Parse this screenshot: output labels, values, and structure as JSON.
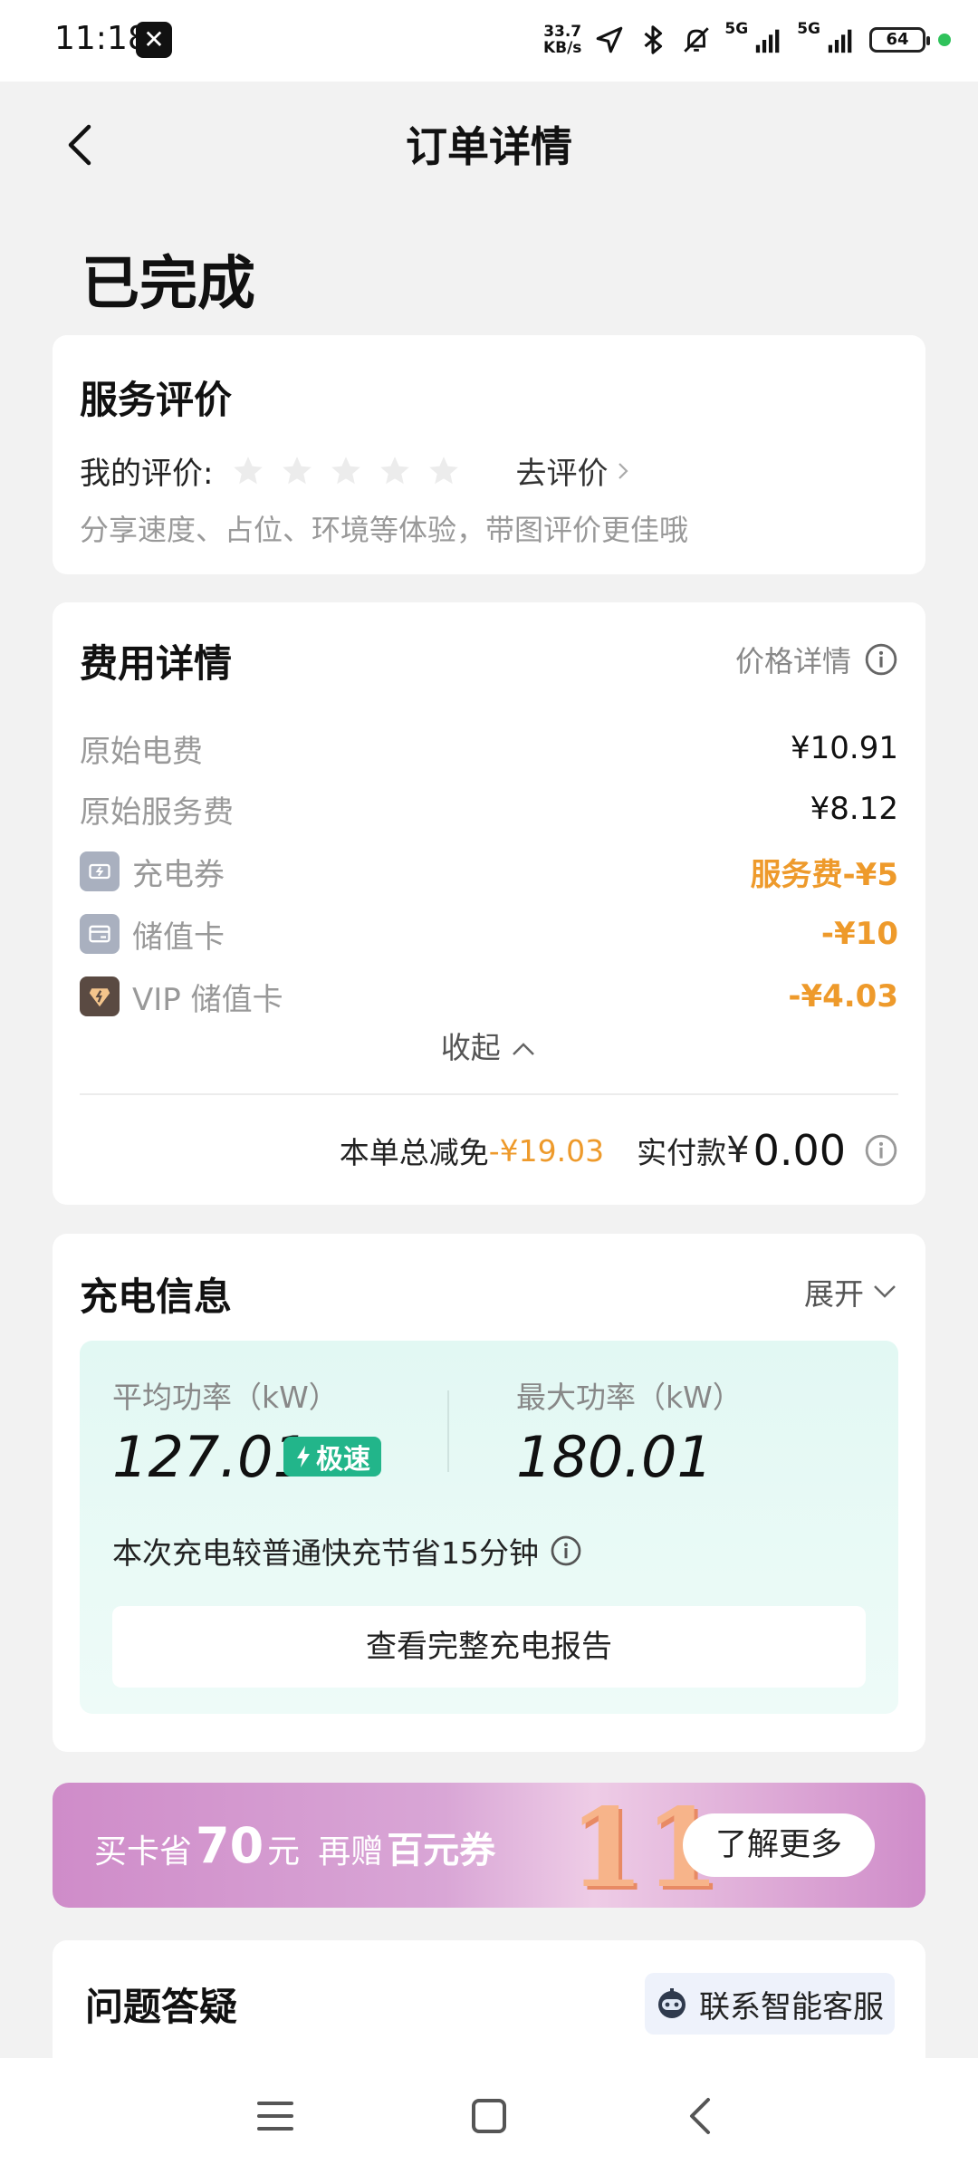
{
  "status_bar": {
    "time": "11:18",
    "notif_icon": "x-app-icon",
    "net_speed_value": "33.7",
    "net_speed_unit": "KB/s",
    "sim1": "5G",
    "sim2": "5G",
    "battery": "64"
  },
  "header": {
    "title": "订单详情",
    "back_icon": "chevron-left-icon"
  },
  "order_status": "已完成",
  "rating": {
    "title": "服务评价",
    "label": "我的评价:",
    "stars_filled": 0,
    "stars_total": 5,
    "go_rate": "去评价",
    "hint": "分享速度、占位、环境等体验，带图评价更佳哦"
  },
  "fees": {
    "title": "费用详情",
    "price_detail": "价格详情",
    "rows": [
      {
        "name": "原始电费",
        "value": "¥10.91",
        "icon": ""
      },
      {
        "name": "原始服务费",
        "value": "¥8.12",
        "icon": ""
      },
      {
        "name": "充电券",
        "value": "服务费-¥5",
        "icon": "coupon-icon"
      },
      {
        "name": "储值卡",
        "value": "-¥10",
        "icon": "card-icon"
      },
      {
        "name": "VIP 储值卡",
        "value": "-¥4.03",
        "icon": "vip-card-icon"
      }
    ],
    "collapse": "收起",
    "total_label": "本单总减免",
    "total_discount": "-¥19.03",
    "paid_label": "实付款",
    "paid_currency": "¥",
    "paid_amount": "0.00"
  },
  "charging": {
    "title": "充电信息",
    "expand": "展开",
    "avg_label": "平均功率（kW）",
    "avg_value": "127.01",
    "fast_badge": "极速",
    "max_label": "最大功率（kW）",
    "max_value": "180.01",
    "save_text": "本次充电较普通快充节省15分钟",
    "report_btn": "查看完整充电报告"
  },
  "promo": {
    "prefix": "买卡省",
    "amount": "70",
    "unit": "元",
    "mid": "再赠",
    "gift": "百元券",
    "event": "11",
    "button": "了解更多"
  },
  "qa": {
    "title": "问题答疑",
    "cs_button": "联系智能客服"
  },
  "colors": {
    "accent_orange": "#ee9a2b",
    "fast_green": "#22b58a",
    "promo_pink": "#cf8cc9"
  }
}
